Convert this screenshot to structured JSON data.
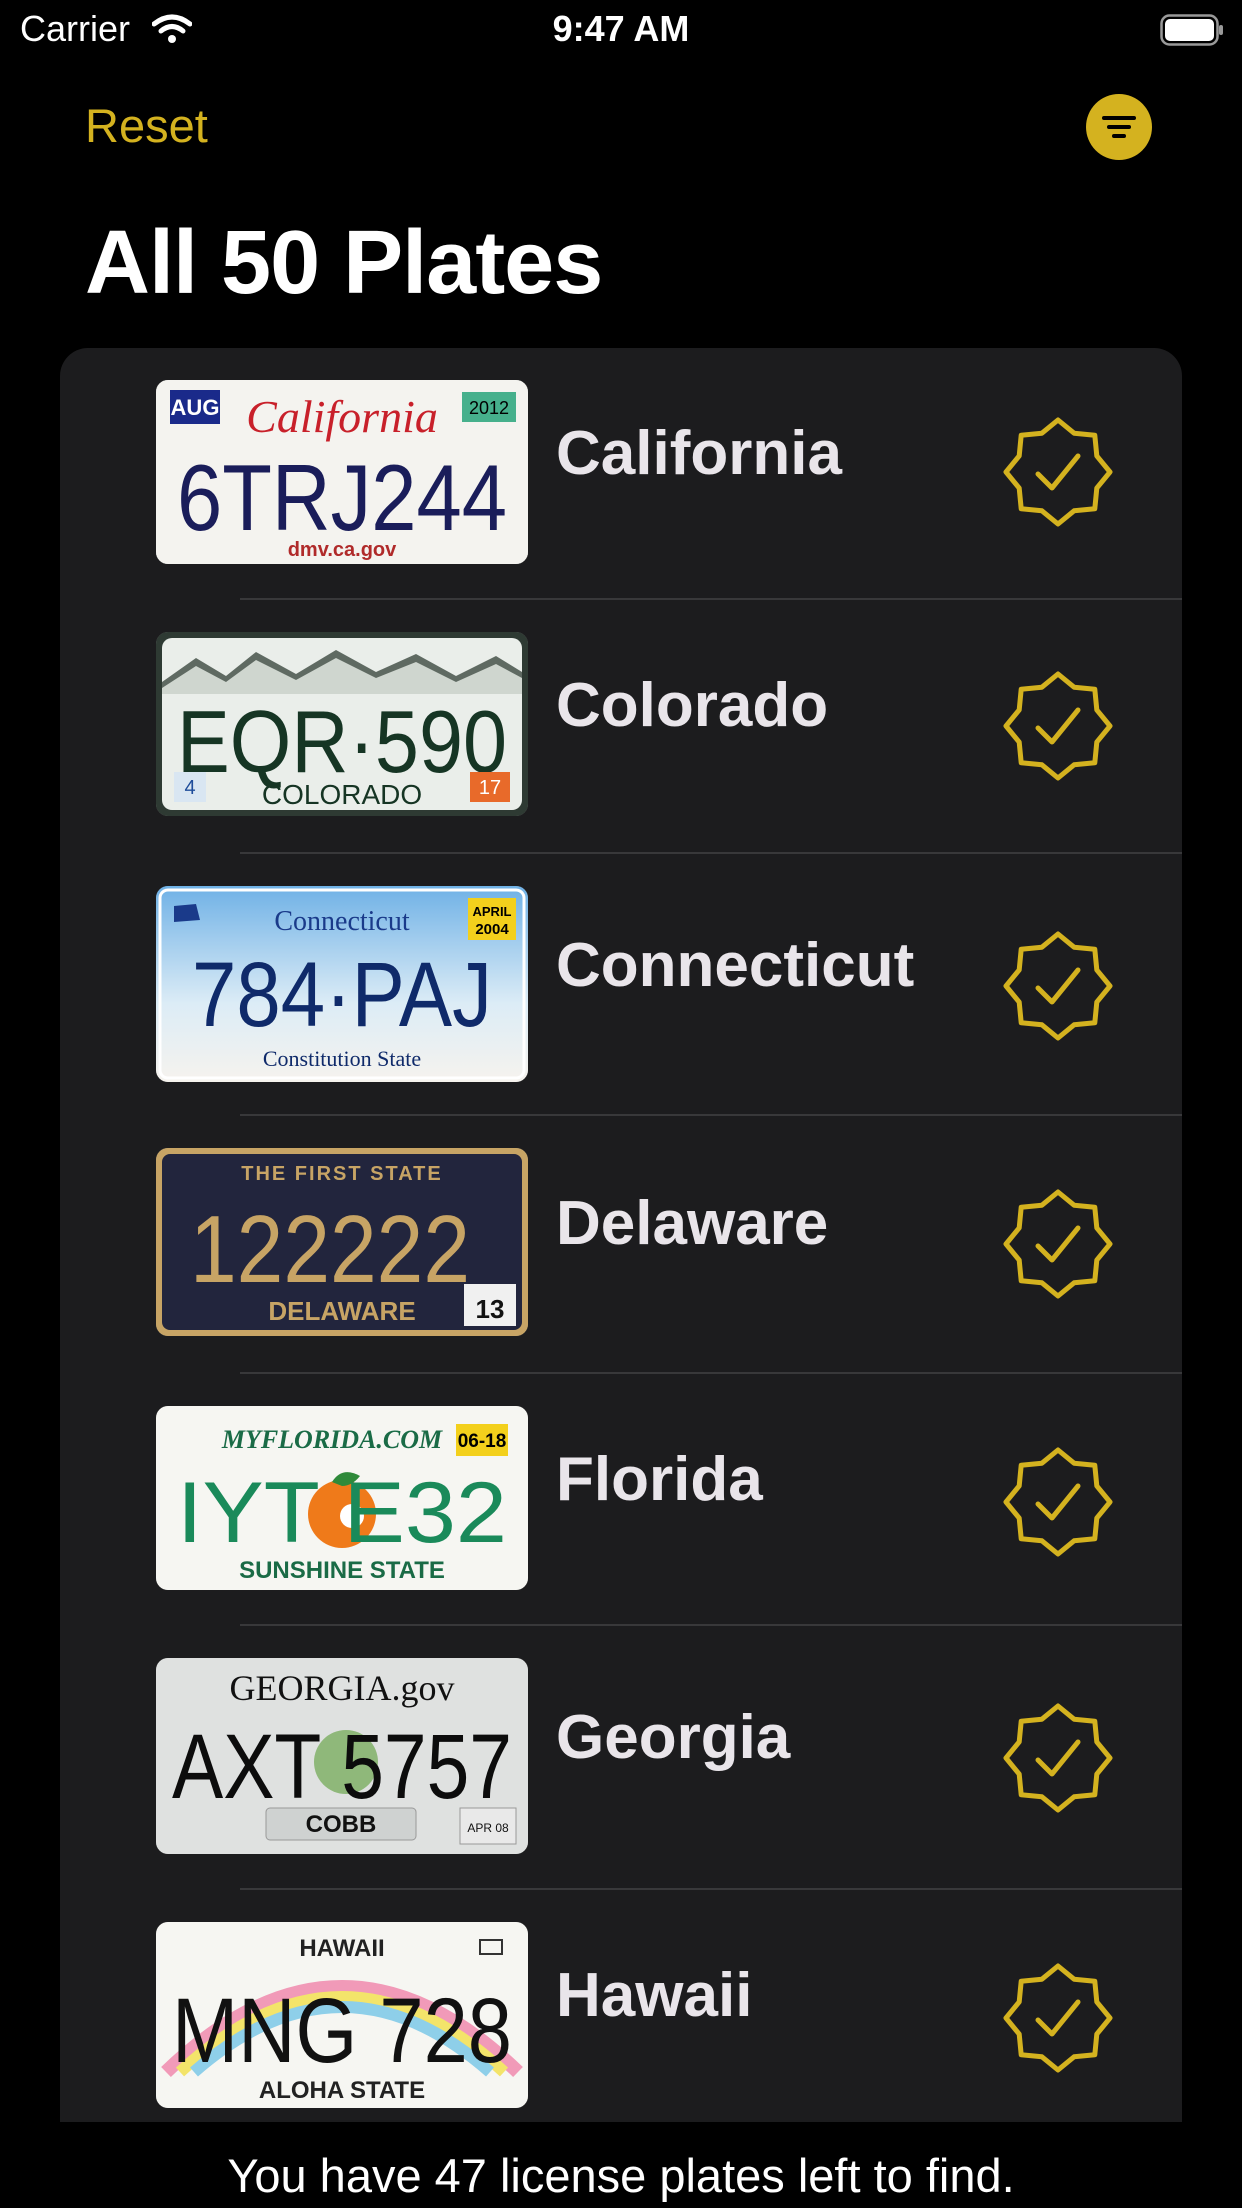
{
  "status_bar": {
    "carrier": "Carrier",
    "time": "9:47 AM"
  },
  "nav": {
    "reset_label": "Reset",
    "filter_icon": "filter-icon"
  },
  "title": "All 50 Plates",
  "plates": [
    {
      "state": "California",
      "found": true,
      "plate_number": "6TRJ244",
      "plate_header": "California",
      "plate_footer": "dmv.ca.gov",
      "plate_month": "AUG",
      "plate_year": "2012"
    },
    {
      "state": "Colorado",
      "found": true,
      "plate_number": "EQR·590",
      "plate_footer": "COLORADO",
      "plate_month": "4",
      "plate_year": "17"
    },
    {
      "state": "Connecticut",
      "found": true,
      "plate_number": "784·PAJ",
      "plate_header": "Connecticut",
      "plate_footer": "Constitution State",
      "plate_month": "APRIL",
      "plate_year": "2004"
    },
    {
      "state": "Delaware",
      "found": true,
      "plate_number": "122222",
      "plate_header": "THE FIRST STATE",
      "plate_footer": "DELAWARE",
      "plate_year": "13"
    },
    {
      "state": "Florida",
      "found": true,
      "plate_number": "IYT E32",
      "plate_header": "MYFLORIDA.COM",
      "plate_footer": "SUNSHINE STATE",
      "plate_year": "06-18"
    },
    {
      "state": "Georgia",
      "found": true,
      "plate_number": "AXT 5757",
      "plate_header": "GEORGIA.gov",
      "plate_footer": "COBB",
      "plate_year": "APR 08"
    },
    {
      "state": "Hawaii",
      "found": true,
      "plate_number": "MNG 728",
      "plate_header": "HAWAII",
      "plate_footer": "ALOHA STATE"
    }
  ],
  "footer_text": "You have 47 license plates left to find.",
  "colors": {
    "accent": "#d4b21f",
    "background": "#000000",
    "card": "#1c1c1e",
    "row_text": "#e9e5ea"
  }
}
